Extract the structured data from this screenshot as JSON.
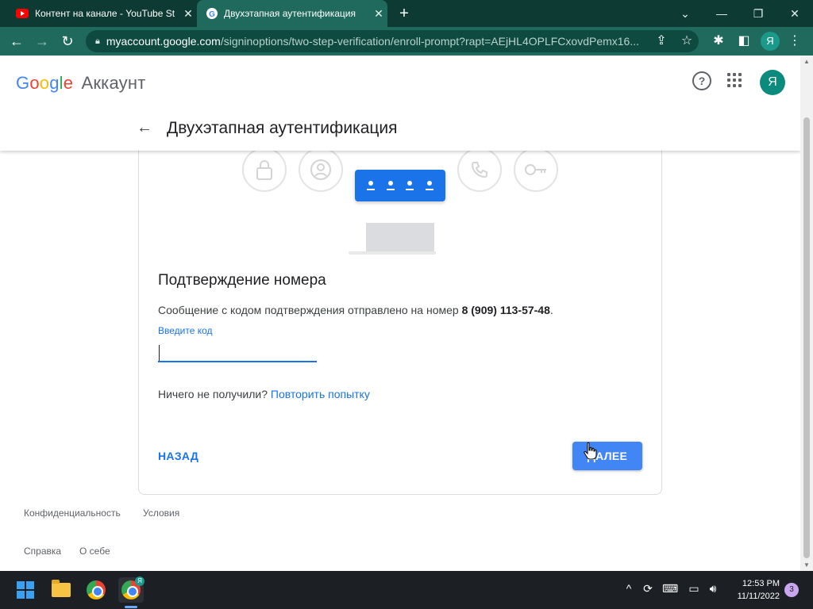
{
  "browser": {
    "tabs": [
      {
        "title": "Контент на канале - YouTube St",
        "icon": "youtube-icon",
        "active": false
      },
      {
        "title": "Двухэтапная аутентификация",
        "icon": "google-icon",
        "active": true
      }
    ],
    "url_host": "myaccount.google.com",
    "url_path": "/signinoptions/two-step-verification/enroll-prompt?rapt=AEjHL4OPLFCxovdPemx16...",
    "profile_initial": "Я"
  },
  "header": {
    "logo": [
      "G",
      "o",
      "o",
      "g",
      "l",
      "e"
    ],
    "product": "Аккаунт",
    "avatar_initial": "Я",
    "page_title": "Двухэтапная аутентификация"
  },
  "card": {
    "title": "Подтверждение номера",
    "message": "Сообщение с кодом подтверждения отправлено на номер",
    "phone": "8 (909) 113-57-48",
    "message_end": ".",
    "code_label": "Введите код",
    "code_value": "",
    "resend_prefix": "Ничего не получили?",
    "resend_link": "Повторить попытку",
    "back_button": "НАЗАД",
    "next_button": "ДАЛЕЕ"
  },
  "footer": {
    "privacy": "Конфиденциальность",
    "terms": "Условия",
    "help": "Справка",
    "about": "О себе"
  },
  "taskbar": {
    "time": "12:53 PM",
    "date": "11/11/2022",
    "notifications": "3",
    "chrome_badge": "Я"
  },
  "colors": {
    "accent": "#1a73e8",
    "tab_bar": "#0d3b33",
    "toolbar": "#1f6a5c",
    "next_button": "#4285f4"
  }
}
